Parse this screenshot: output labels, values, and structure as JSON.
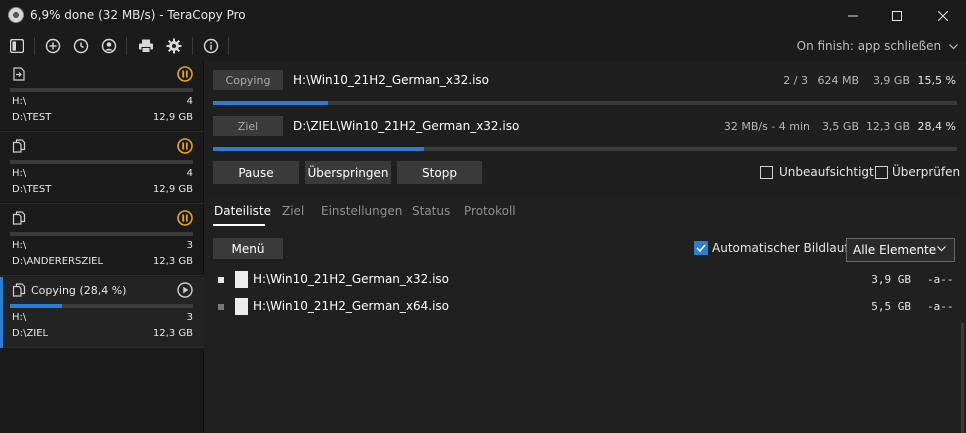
{
  "window": {
    "title": "6,9% done (32 MB/s) - TeraCopy Pro"
  },
  "toolbar": {
    "icons": [
      "panel-toggle-icon",
      "add-icon",
      "history-icon",
      "user-icon",
      "print-icon",
      "gear-icon",
      "info-icon"
    ],
    "on_finish": "On finish: app schließen"
  },
  "jobs": [
    {
      "icon": "move-icon",
      "label": "",
      "state": "paused",
      "progress": 0,
      "src": "H:\\",
      "src_count": "4",
      "dst": "D:\\TEST",
      "dst_size": "12,9 GB"
    },
    {
      "icon": "copy-icon",
      "label": "",
      "state": "paused",
      "progress": 0,
      "src": "H:\\",
      "src_count": "4",
      "dst": "D:\\TEST",
      "dst_size": "12,9 GB"
    },
    {
      "icon": "copy-icon",
      "label": "",
      "state": "paused",
      "progress": 0,
      "src": "H:\\",
      "src_count": "3",
      "dst": "D:\\ANDERERSZIEL",
      "dst_size": "12,3 GB"
    },
    {
      "icon": "copy-icon",
      "label": "Copying (28,4 %)",
      "state": "running",
      "progress": 0.284,
      "src": "H:\\",
      "src_count": "3",
      "dst": "D:\\ZIEL",
      "dst_size": "12,3 GB"
    }
  ],
  "source": {
    "tag": "Copying",
    "path": "H:\\Win10_21H2_German_x32.iso",
    "count": "2 / 3",
    "done": "624 MB",
    "total": "3,9 GB",
    "percent": "15,5 %",
    "progress": 0.155
  },
  "target": {
    "tag": "Ziel",
    "path": "D:\\ZIEL\\Win10_21H2_German_x32.iso",
    "speed": "32 MB/s - 4 min",
    "done": "3,5 GB",
    "total": "12,3 GB",
    "percent": "28,4 %",
    "progress": 0.284
  },
  "actions": {
    "pause": "Pause",
    "skip": "Überspringen",
    "stop": "Stopp",
    "unattended": "Unbeaufsichtigt",
    "verify": "Überprüfen"
  },
  "tabs": [
    "Dateiliste",
    "Ziel",
    "Einstellungen",
    "Status",
    "Protokoll"
  ],
  "filelist": {
    "menu": "Menü",
    "autoscroll": "Automatischer Bildlauf",
    "filter": "Alle Elemente",
    "files": [
      {
        "name": "H:\\Win10_21H2_German_x32.iso",
        "size": "3,9 GB",
        "attr": "-a--",
        "current": true
      },
      {
        "name": "H:\\Win10_21H2_German_x64.iso",
        "size": "5,5 GB",
        "attr": "-a--",
        "current": false
      }
    ]
  },
  "colors": {
    "accent": "#2a7fd4",
    "pause": "#e8a21b"
  }
}
